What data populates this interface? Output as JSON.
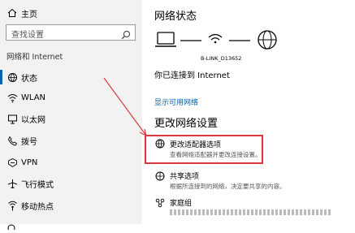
{
  "sidebar": {
    "home_label": "主页",
    "search_placeholder": "查找设置",
    "section_title": "网络和 Internet",
    "items": [
      {
        "label": "状态",
        "icon": "home-globe-icon"
      },
      {
        "label": "WLAN",
        "icon": "wifi-icon"
      },
      {
        "label": "以太网",
        "icon": "ethernet-icon"
      },
      {
        "label": "拨号",
        "icon": "dialup-icon"
      },
      {
        "label": "VPN",
        "icon": "vpn-icon"
      },
      {
        "label": "飞行模式",
        "icon": "airplane-icon"
      },
      {
        "label": "移动热点",
        "icon": "hotspot-icon"
      }
    ]
  },
  "main": {
    "status_title": "网络状态",
    "network_name": "B-LINK_D13652",
    "connected_text": "你已连接到 Internet",
    "view_adapters_link": "显示可用网络",
    "change_settings_title": "更改网络设置",
    "options": [
      {
        "title": "更改适配器选项",
        "desc": "查看网络适配器并更改连接设置。",
        "icon": "globe-adapter-icon"
      },
      {
        "title": "共享选项",
        "desc": "根据所连接到的网络，决定要共享的内容。",
        "icon": "sharing-icon"
      },
      {
        "title": "家庭组",
        "desc": "",
        "icon": "homegroup-icon"
      }
    ]
  },
  "colors": {
    "accent": "#0063b1",
    "highlight": "#d9363e",
    "sidebar_bg": "#f2f2f2"
  }
}
